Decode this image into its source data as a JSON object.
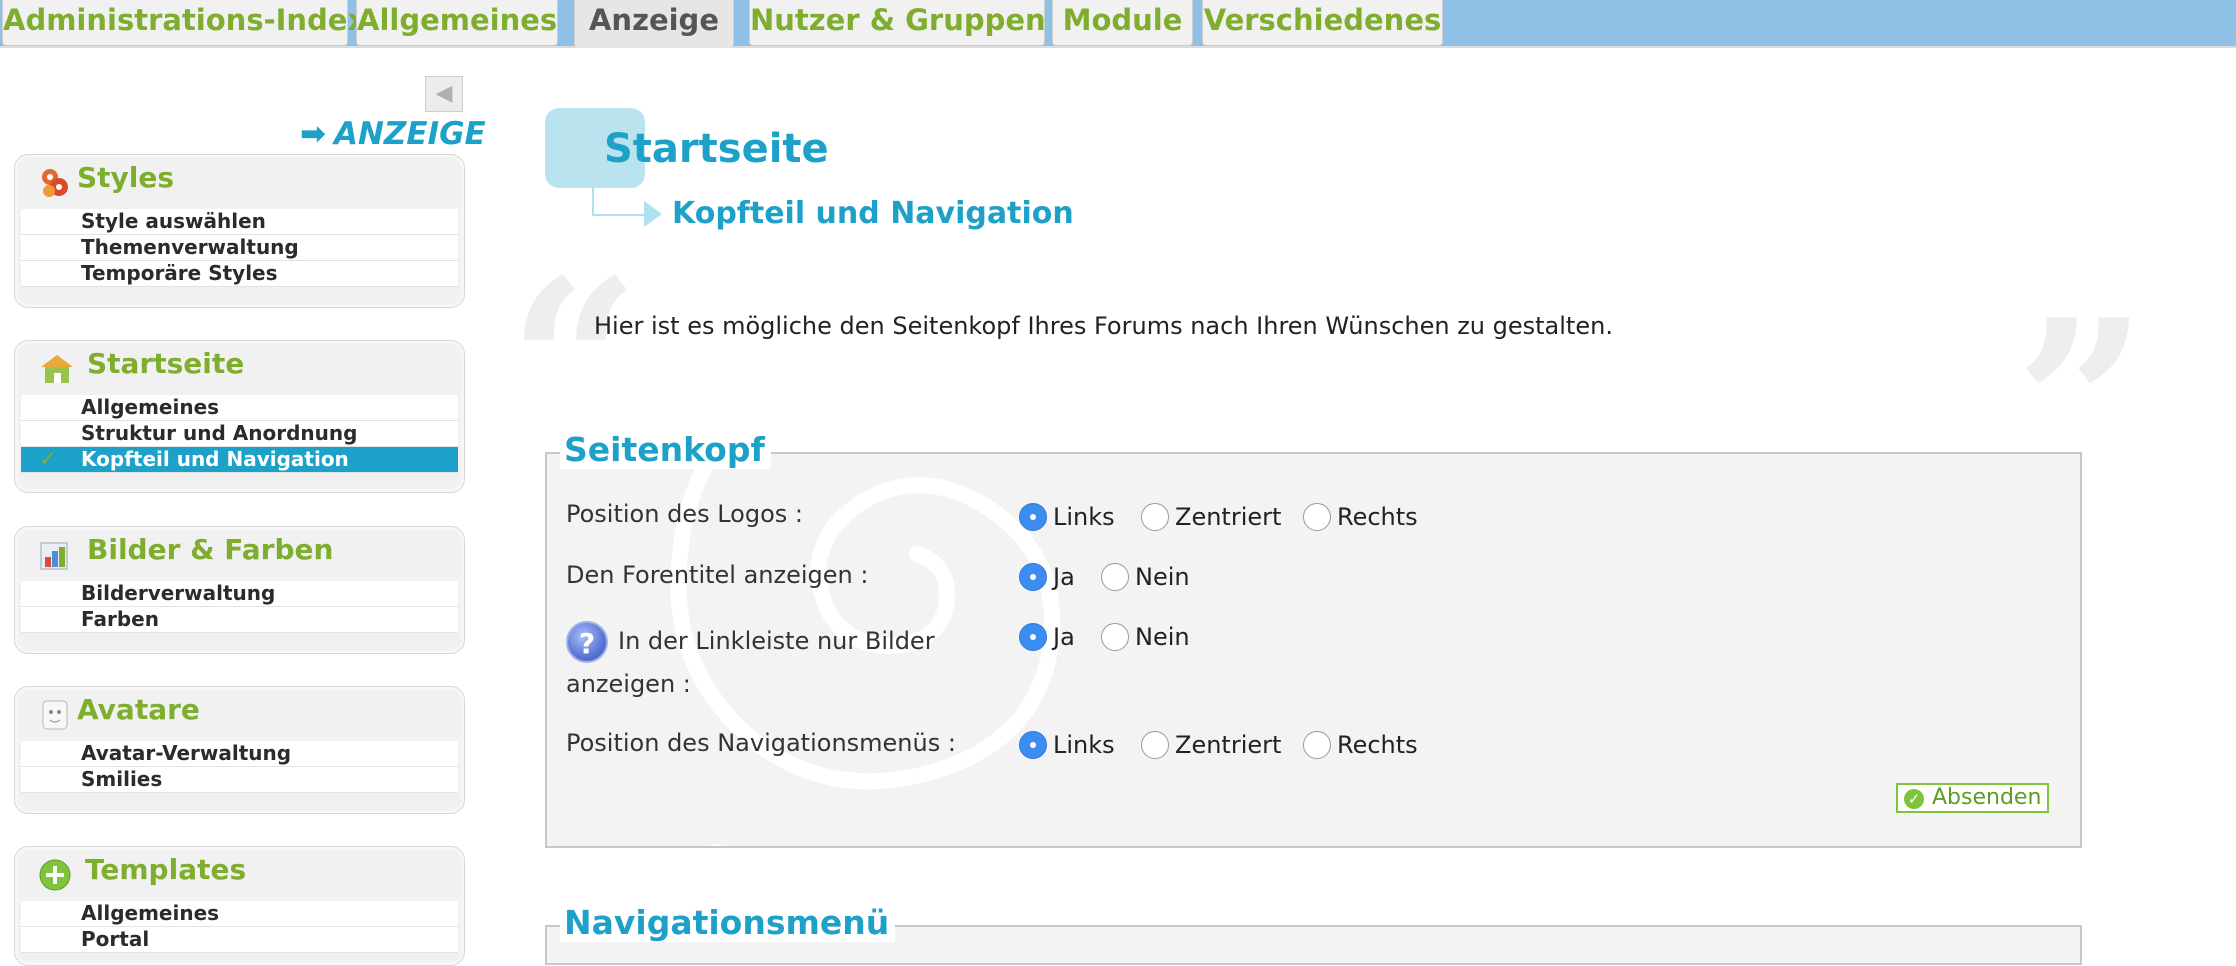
{
  "tabs": [
    {
      "label": "Administrations-Index",
      "active": false
    },
    {
      "label": "Allgemeines",
      "active": false
    },
    {
      "label": "Anzeige",
      "active": true
    },
    {
      "label": "Nutzer & Gruppen",
      "active": false
    },
    {
      "label": "Module",
      "active": false
    },
    {
      "label": "Verschiedenes",
      "active": false
    }
  ],
  "sidebar": {
    "collapse_icon": "triangle-left-icon",
    "title": "ANZEIGE",
    "sections": [
      {
        "title": "Styles",
        "icon": "styles-icon",
        "items": [
          "Style auswählen",
          "Themenverwaltung",
          "Temporäre Styles"
        ]
      },
      {
        "title": "Startseite",
        "icon": "home-icon",
        "items": [
          "Allgemeines",
          "Struktur und Anordnung",
          "Kopfteil und Navigation"
        ],
        "active_item": 2
      },
      {
        "title": "Bilder & Farben",
        "icon": "palette-icon",
        "items": [
          "Bilderverwaltung",
          "Farben"
        ]
      },
      {
        "title": "Avatare",
        "icon": "avatar-icon",
        "items": [
          "Avatar-Verwaltung",
          "Smilies"
        ]
      },
      {
        "title": "Templates",
        "icon": "plus-circle-icon",
        "items": [
          "Allgemeines",
          "Portal"
        ]
      }
    ]
  },
  "main": {
    "title": "Startseite",
    "subtitle": "Kopfteil und Navigation",
    "intro": "Hier ist es mögliche den Seitenkopf Ihres Forums nach Ihren Wünschen zu gestalten.",
    "fieldset": {
      "legend": "Seitenkopf",
      "fields": [
        {
          "label": "Position des Logos :",
          "options": [
            "Links",
            "Zentriert",
            "Rechts"
          ],
          "selected": "Links"
        },
        {
          "label": "Den Forentitel anzeigen :",
          "options": [
            "Ja",
            "Nein"
          ],
          "selected": "Ja"
        },
        {
          "label_line1": "In der Linkleiste nur Bilder",
          "label_line2": "anzeigen :",
          "help_icon": "?",
          "options": [
            "Ja",
            "Nein"
          ],
          "selected": "Ja"
        },
        {
          "label": "Position des Navigationsmenüs :",
          "options": [
            "Links",
            "Zentriert",
            "Rechts"
          ],
          "selected": "Links"
        }
      ],
      "submit_label": "Absenden"
    },
    "next_legend": "Navigationsmenü"
  },
  "colors": {
    "accent_blue": "#1ea1c8",
    "accent_green": "#7fae2e",
    "topbar": "#8fc0e6"
  }
}
